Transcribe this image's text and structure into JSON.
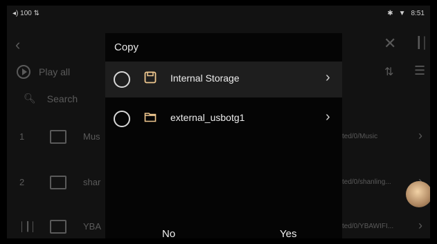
{
  "status": {
    "left": "◂) 100 ⇅",
    "bluetooth": "✱",
    "wifi": "▼",
    "time": "8:51"
  },
  "background": {
    "play_all": "Play all",
    "search_placeholder": "Search",
    "rows": [
      {
        "num": "1",
        "name": "Mus",
        "path": "ted/0/Music"
      },
      {
        "num": "2",
        "name": "shar",
        "path": "ted/0/shanling..."
      },
      {
        "num": "│┃│",
        "name": "YBA",
        "path": "ted/0/YBAWIFI..."
      }
    ]
  },
  "dialog": {
    "title": "Copy",
    "options": [
      {
        "label": "Internal Storage",
        "icon": "sd-card-icon"
      },
      {
        "label": "external_usbotg1",
        "icon": "folder-icon"
      }
    ],
    "no_label": "No",
    "yes_label": "Yes"
  },
  "colors": {
    "accent": "#f0c890",
    "dialog_bg": "#050505",
    "selected_row": "#1e1e1e"
  }
}
